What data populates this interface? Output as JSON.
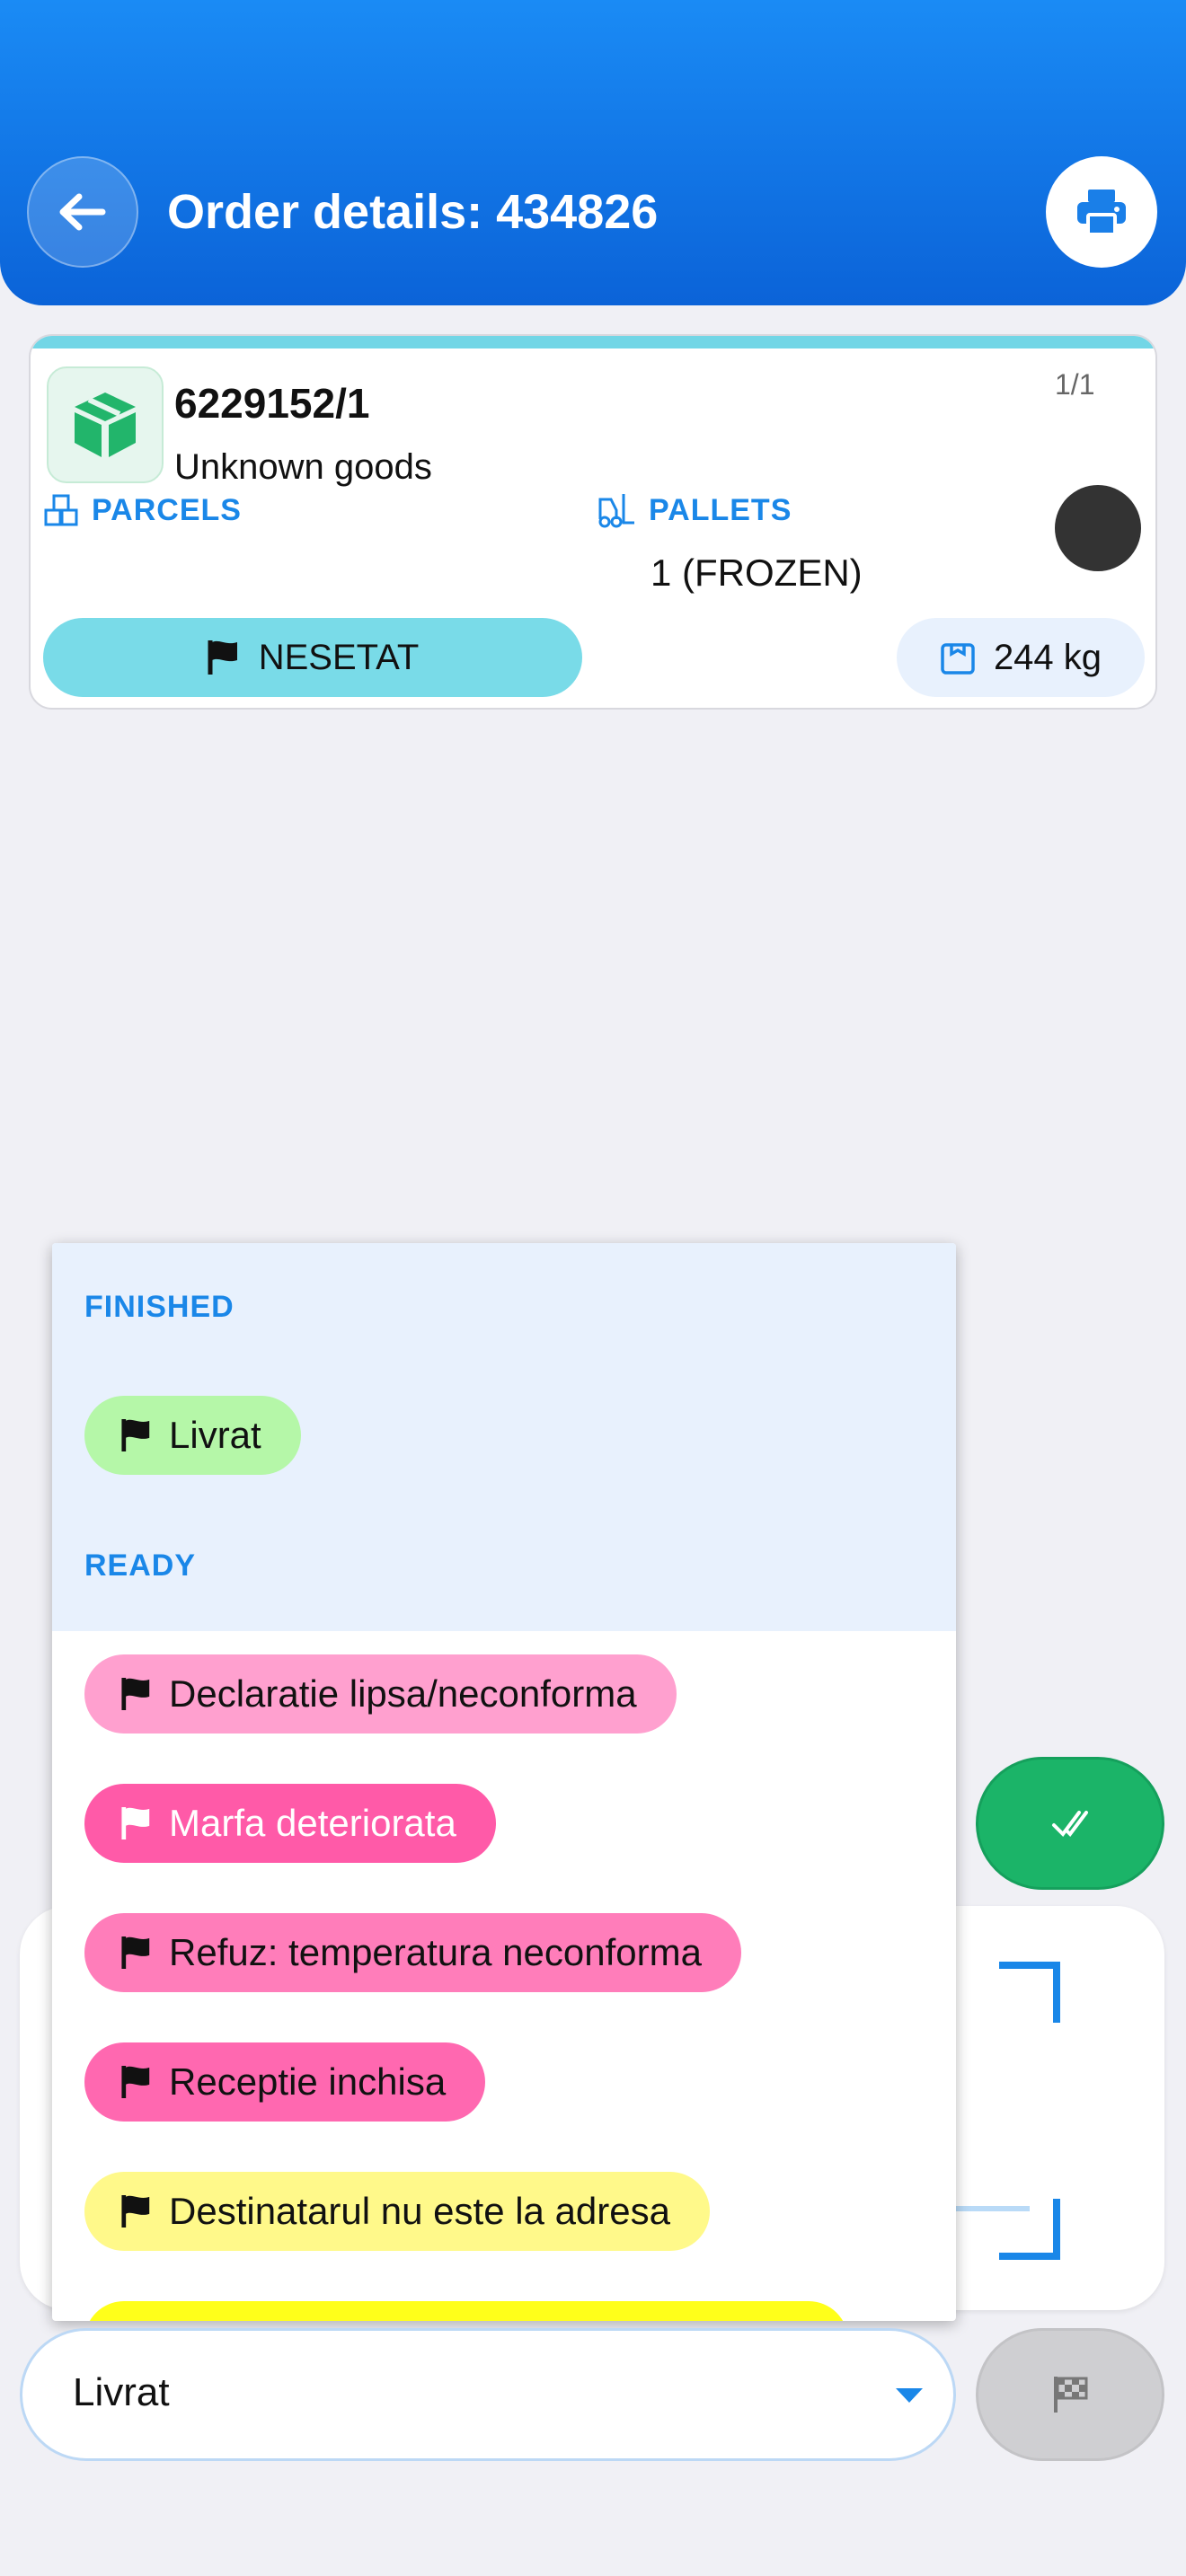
{
  "header": {
    "title": "Order details: 434826",
    "back_icon": "arrow-left-icon",
    "print_icon": "printer-icon",
    "color": "#0b63d8"
  },
  "card": {
    "order_number": "6229152/1",
    "goods": "Unknown goods",
    "counter": "1/1",
    "parcels_label": "PARCELS",
    "pallets_label": "PALLETS",
    "pallets_value": "1 (FROZEN)",
    "status_label": "NESETAT",
    "weight": "244 kg",
    "accent_color": "#72d6e6"
  },
  "dropdown": {
    "groups": [
      {
        "header": "FINISHED",
        "options": [
          {
            "label": "Livrat",
            "color": "#b5f7a8",
            "text_color": "#111111",
            "flag": "#111111"
          }
        ]
      },
      {
        "header": "READY",
        "options": [
          {
            "label": "Declaratie lipsa/neconforma",
            "color": "#ffa0cf",
            "text_color": "#111111",
            "flag": "#111111"
          },
          {
            "label": "Marfa deteriorata",
            "color": "#ff5aa8",
            "text_color": "#ffffff",
            "flag": "#ffffff"
          },
          {
            "label": "Refuz: temperatura neconforma",
            "color": "#ff7dba",
            "text_color": "#111111",
            "flag": "#111111"
          },
          {
            "label": "Receptie inchisa",
            "color": "#ff68b0",
            "text_color": "#111111",
            "flag": "#111111"
          },
          {
            "label": "Destinatarul nu este la adresa",
            "color": "#fff98a",
            "text_color": "#111111",
            "flag": "#111111"
          }
        ]
      }
    ]
  },
  "select": {
    "value": "Livrat"
  },
  "actions": {
    "confirm_icon": "double-check-icon",
    "finish_icon": "checkered-flag-icon"
  }
}
